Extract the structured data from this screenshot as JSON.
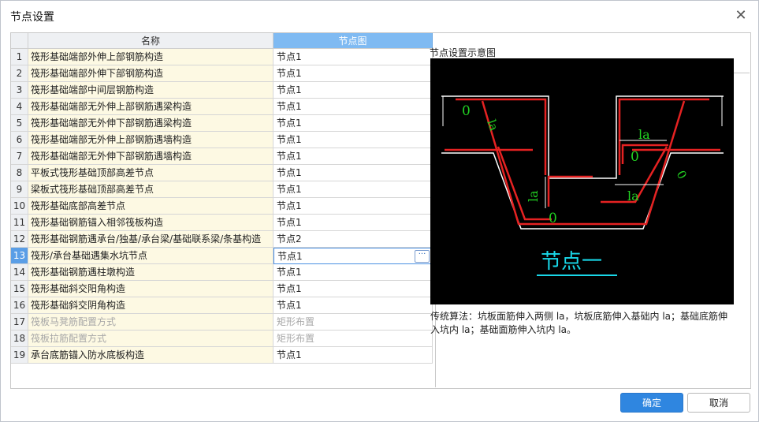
{
  "window": {
    "title": "节点设置",
    "close_icon": "close-icon"
  },
  "table": {
    "headers": {
      "name": "名称",
      "node": "节点图"
    },
    "rows": [
      {
        "num": "1",
        "name": "筏形基础端部外伸上部钢筋构造",
        "node": "节点1"
      },
      {
        "num": "2",
        "name": "筏形基础端部外伸下部钢筋构造",
        "node": "节点1"
      },
      {
        "num": "3",
        "name": "筏形基础端部中间层钢筋构造",
        "node": "节点1"
      },
      {
        "num": "4",
        "name": "筏形基础端部无外伸上部钢筋遇梁构造",
        "node": "节点1"
      },
      {
        "num": "5",
        "name": "筏形基础端部无外伸下部钢筋遇梁构造",
        "node": "节点1"
      },
      {
        "num": "6",
        "name": "筏形基础端部无外伸上部钢筋遇墙构造",
        "node": "节点1"
      },
      {
        "num": "7",
        "name": "筏形基础端部无外伸下部钢筋遇墙构造",
        "node": "节点1"
      },
      {
        "num": "8",
        "name": "平板式筏形基础顶部高差节点",
        "node": "节点1"
      },
      {
        "num": "9",
        "name": "梁板式筏形基础顶部高差节点",
        "node": "节点1"
      },
      {
        "num": "10",
        "name": "筏形基础底部高差节点",
        "node": "节点1"
      },
      {
        "num": "11",
        "name": "筏形基础钢筋锚入相邻筏板构造",
        "node": "节点1"
      },
      {
        "num": "12",
        "name": "筏形基础钢筋遇承台/独基/承台梁/基础联系梁/条基构造",
        "node": "节点2"
      },
      {
        "num": "13",
        "name": "筏形/承台基础遇集水坑节点",
        "node": "节点1"
      },
      {
        "num": "14",
        "name": "筏形基础钢筋遇柱墩构造",
        "node": "节点1"
      },
      {
        "num": "15",
        "name": "筏形基础斜交阳角构造",
        "node": "节点1"
      },
      {
        "num": "16",
        "name": "筏形基础斜交阴角构造",
        "node": "节点1"
      },
      {
        "num": "17",
        "name": "筏板马凳筋配置方式",
        "node": "矩形布置"
      },
      {
        "num": "18",
        "name": "筏板拉筋配置方式",
        "node": "矩形布置"
      },
      {
        "num": "19",
        "name": "承台底筋锚入防水底板构造",
        "node": "节点1"
      }
    ],
    "selected_row": "13",
    "disabled_rows": [
      "17",
      "18"
    ],
    "more_button": "···"
  },
  "preview": {
    "label": "节点设置示意图",
    "diagram_labels": {
      "a": "0",
      "b": "la",
      "c": "la",
      "d": "0",
      "e": "la",
      "f": "0",
      "g": "la",
      "h": "0"
    },
    "caption": "节点一",
    "description": "传统算法：坑板面筋伸入两侧 la，坑板底筋伸入基础内 la；基础底筋伸入坑内 la；基础面筋伸入坑内 la。"
  },
  "buttons": {
    "ok": "确定",
    "cancel": "取消"
  },
  "colors": {
    "accent": "#2f86e0",
    "header_selected": "#7fbaf2",
    "name_cell_bg": "#fdf9e3",
    "rebar": "#e52222",
    "outline": "#ffffff",
    "dim_text": "#22d122",
    "caption": "#19d7e8"
  }
}
